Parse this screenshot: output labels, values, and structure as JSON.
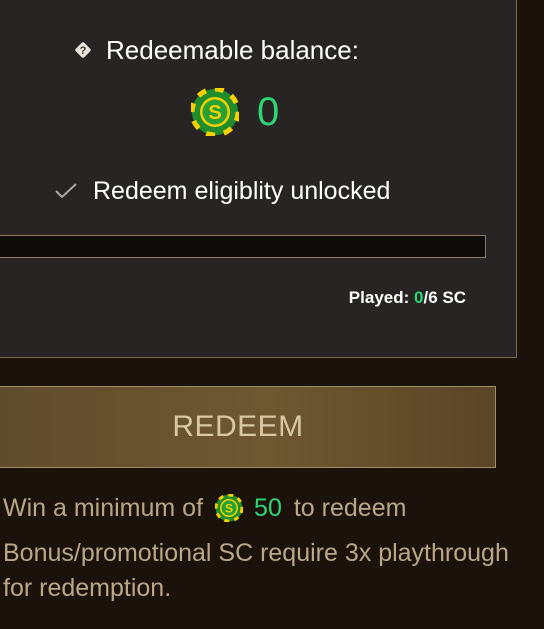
{
  "balance": {
    "label": "Redeemable balance:",
    "value": "0",
    "help_icon": "help-diamond-icon",
    "coin_icon": "sweeps-coin-icon"
  },
  "eligibility": {
    "icon": "check-icon",
    "text": "Redeem eligiblity unlocked"
  },
  "progress": {
    "fraction": 0,
    "played_label": "Played: ",
    "played_value": "0",
    "played_total": "/6 SC"
  },
  "redeem_button": {
    "label": "REDEEM"
  },
  "minimum": {
    "prefix": "Win a minimum of",
    "value": "50",
    "suffix": "to redeem"
  },
  "bonus_note": "Bonus/promotional SC require 3x playthrough for redemption.",
  "colors": {
    "accent_green": "#2ed573",
    "panel_bg": "#282423",
    "page_bg": "#1c120c",
    "button_gold": "#6e5832",
    "muted_text": "#b8a888"
  }
}
